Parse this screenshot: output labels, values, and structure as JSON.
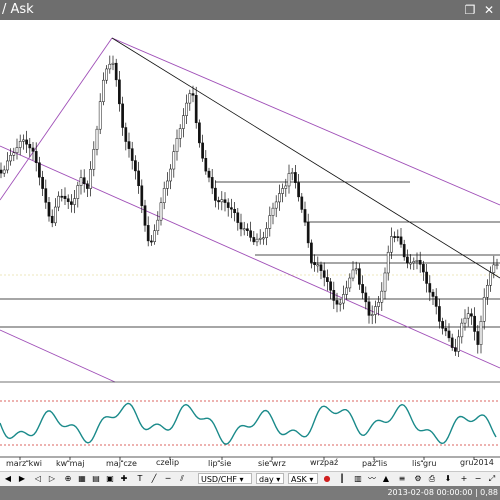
{
  "window": {
    "title": "/ Ask",
    "restore_icon": "restore-icon",
    "close_icon": "close-icon"
  },
  "chart_data": {
    "type": "candlestick",
    "symbol": "USD/CHF",
    "x_tick_labels": [
      "marzkwi",
      "kwmaj",
      "majcze",
      "czelip",
      "lipsie",
      "siewrz",
      "wrzpaź",
      "paźlis",
      "lisgru",
      "gru2014"
    ],
    "colors": {
      "candles": "#111111",
      "channel": "#a050b8",
      "indicator": "#1a8a8a",
      "indicator_bounds": "#d0342c"
    }
  },
  "toolbar": {
    "symbol": "USD/CHF",
    "period": "day",
    "side": "ASK"
  },
  "status": {
    "text": "2013-02-08 00:00:00 | 0,88"
  }
}
